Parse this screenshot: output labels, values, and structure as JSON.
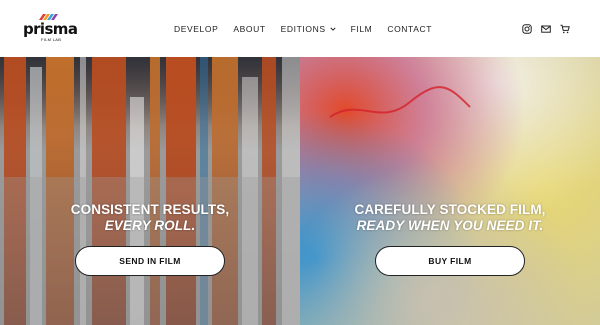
{
  "brand": {
    "name": "prisma",
    "tagline": "FILM LAB"
  },
  "nav": {
    "items": [
      {
        "label": "DEVELOP"
      },
      {
        "label": "ABOUT"
      },
      {
        "label": "EDITIONS"
      },
      {
        "label": "FILM"
      },
      {
        "label": "CONTACT"
      }
    ]
  },
  "header_icons": [
    "instagram-icon",
    "mail-icon",
    "cart-icon"
  ],
  "hero": {
    "left": {
      "headline": "CONSISTENT RESULTS,",
      "subline": "EVERY ROLL.",
      "button_label": "SEND IN FILM"
    },
    "right": {
      "headline": "CAREFULLY STOCKED FILM,",
      "subline": "READY WHEN YOU NEED IT.",
      "button_label": "BUY FILM"
    }
  },
  "colors": {
    "brand_stripes": [
      "#e23b3b",
      "#f39c1f",
      "#3aa3e0",
      "#8e44ad"
    ],
    "text": "#1a1a1a",
    "button_bg": "#ffffff"
  }
}
